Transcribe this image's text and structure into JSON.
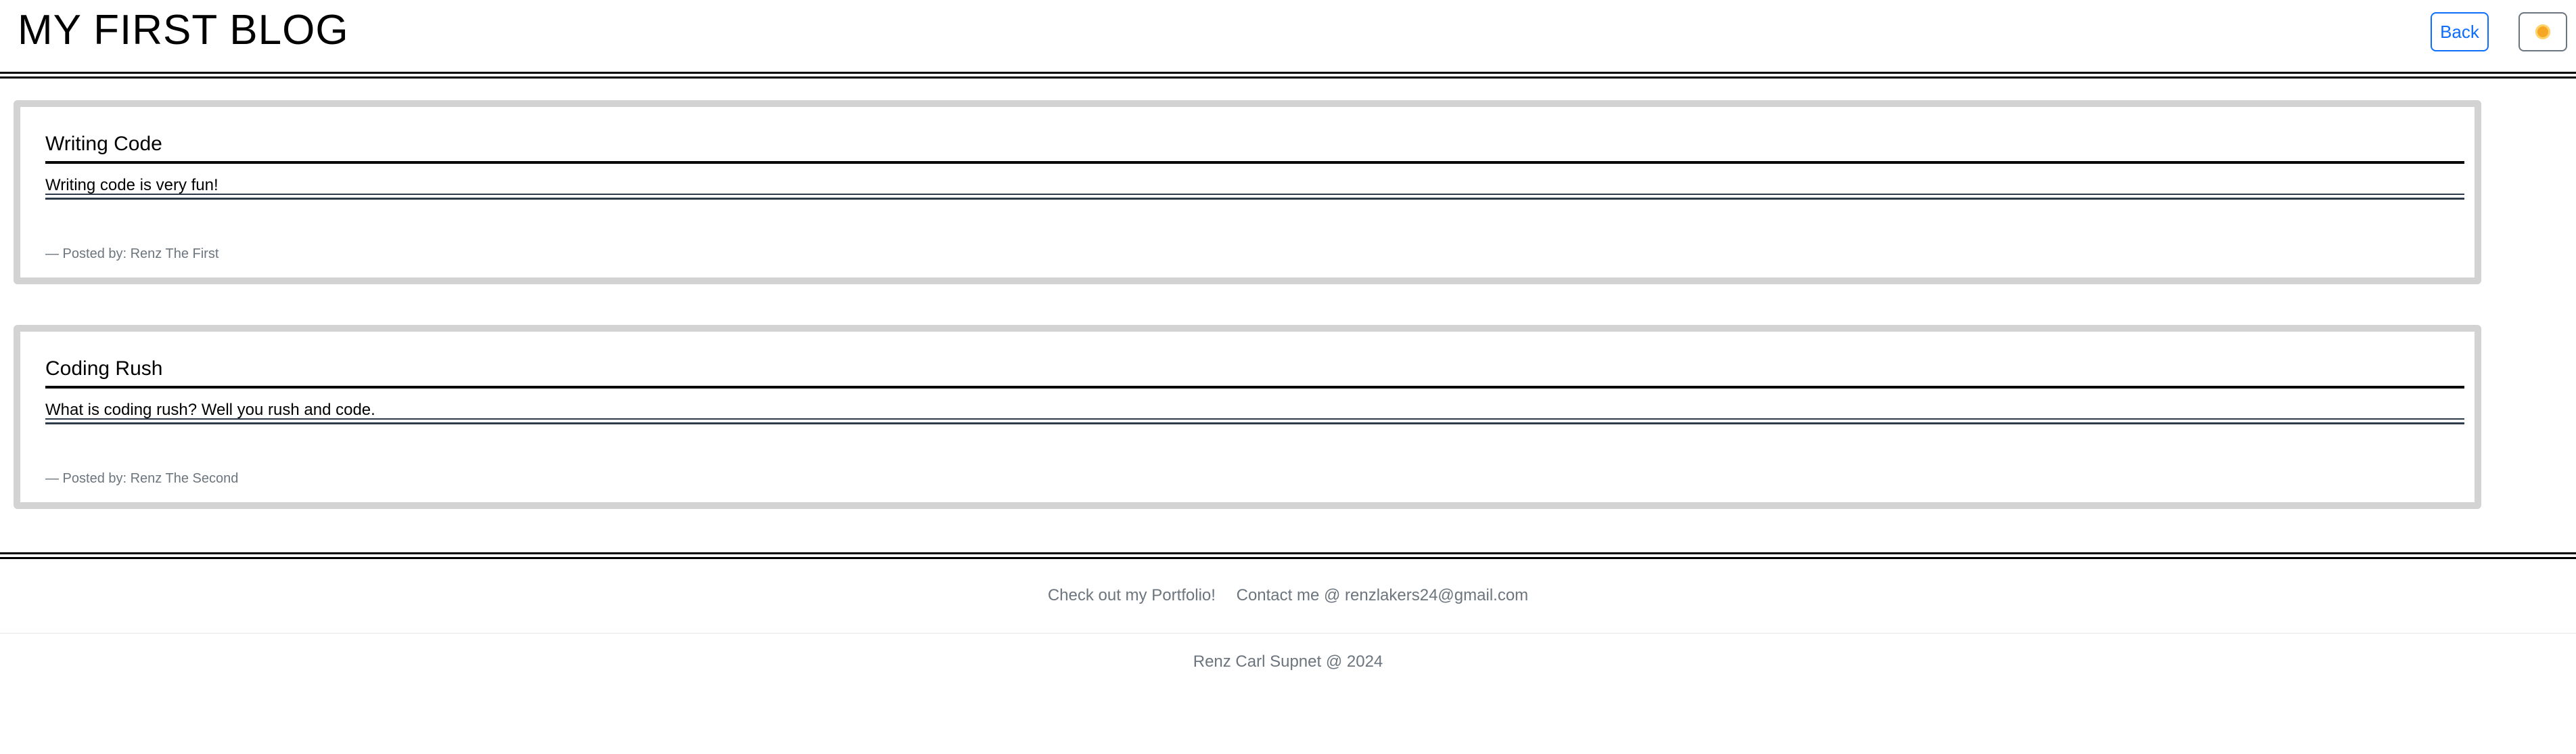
{
  "header": {
    "site_title": "MY FIRST BLOG",
    "back_label": "Back",
    "theme_icon": "sun-icon"
  },
  "posts": [
    {
      "title": "Writing Code",
      "body": "Writing code is very fun!",
      "author": "— Posted by: Renz The First"
    },
    {
      "title": "Coding Rush",
      "body": "What is coding rush? Well you rush and code.",
      "author": "— Posted by: Renz The Second"
    }
  ],
  "footer": {
    "portfolio_link": "Check out my Portfolio!",
    "contact_text": "Contact me @ renzlakers24@gmail.com",
    "copyright": "Renz Carl Supnet @ 2024"
  },
  "colors": {
    "accent": "#0d6efd",
    "muted": "#6c757d",
    "card_border": "#d3d3d3"
  }
}
